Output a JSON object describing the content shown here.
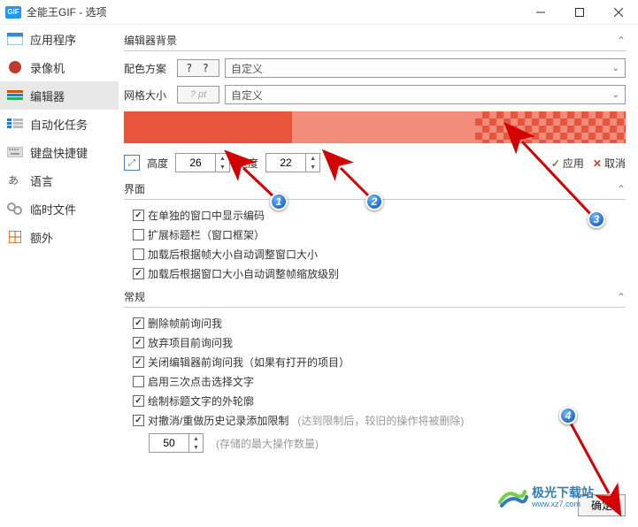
{
  "titlebar": {
    "icon": "GIF",
    "text": "全能王GIF - 选项"
  },
  "sidebar": {
    "items": [
      {
        "label": "应用程序"
      },
      {
        "label": "录像机"
      },
      {
        "label": "编辑器"
      },
      {
        "label": "自动化任务"
      },
      {
        "label": "键盘快捷键"
      },
      {
        "label": "语言"
      },
      {
        "label": "临时文件"
      },
      {
        "label": "额外"
      }
    ]
  },
  "sections": {
    "bg": {
      "title": "编辑器背景",
      "scheme_label": "配色方案",
      "scheme_swatch": "?  ?",
      "scheme_value": "自定义",
      "grid_label": "网格大小",
      "grid_pt": "? pt",
      "grid_value": "自定义",
      "height_label": "高度",
      "height_value": "26",
      "width_label": "宽度",
      "width_value": "22",
      "apply": "应用",
      "cancel": "取消"
    },
    "ui": {
      "title": "界面",
      "c1": "在单独的窗口中显示编码",
      "c2": "扩展标题栏（窗口框架）",
      "c3": "加载后根据帧大小自动调整窗口大小",
      "c4": "加载后根据窗口大小自动调整帧缩放级别"
    },
    "gen": {
      "title": "常规",
      "c1": "删除帧前询问我",
      "c2": "放弃项目前询问我",
      "c3": "关闭编辑器前询问我（如果有打开的项目）",
      "c4": "启用三次点击选择文字",
      "c5": "绘制标题文字的外轮廓",
      "c6": "对撤消/重做历史记录添加限制",
      "c6_hint": "(达到限制后，较旧的操作将被删除)",
      "limit_value": "50",
      "limit_hint": "(存储的最大操作数量)"
    }
  },
  "footer": {
    "ok": "确定"
  },
  "watermark": {
    "cn": "极光下载站",
    "url": "www.xz7.com"
  },
  "annotations": {
    "n1": "1",
    "n2": "2",
    "n3": "3",
    "n4": "4"
  }
}
